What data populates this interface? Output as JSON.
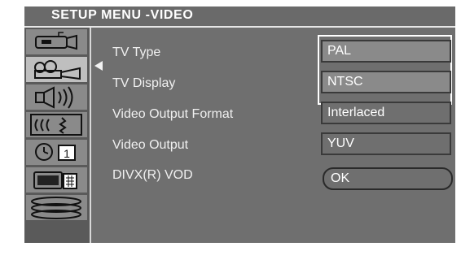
{
  "header": {
    "title": "SETUP MENU -VIDEO"
  },
  "sidebar": {
    "items": [
      {
        "icon": "camcorder-icon",
        "active": false
      },
      {
        "icon": "projector-icon",
        "active": true
      },
      {
        "icon": "speaker-icon",
        "active": false
      },
      {
        "icon": "audio-wave-icon",
        "active": false
      },
      {
        "icon": "timer-icon",
        "active": false,
        "text": "1"
      },
      {
        "icon": "tv-remote-icon",
        "active": false
      },
      {
        "icon": "disc-stack-icon",
        "active": false
      }
    ]
  },
  "menu": {
    "items": [
      {
        "label": "TV Type",
        "value": "PAL"
      },
      {
        "label": "TV Display",
        "value": "NTSC"
      },
      {
        "label": "Video Output Format",
        "value": "Interlaced"
      },
      {
        "label": "Video Output",
        "value": "YUV"
      },
      {
        "label": "DIVX(R) VOD",
        "value": "OK"
      }
    ]
  },
  "colors": {
    "background": "#6f6f6f",
    "sidebar": "#5a5a5a",
    "active_item": "#bfbfbf",
    "text": "#ffffff"
  }
}
